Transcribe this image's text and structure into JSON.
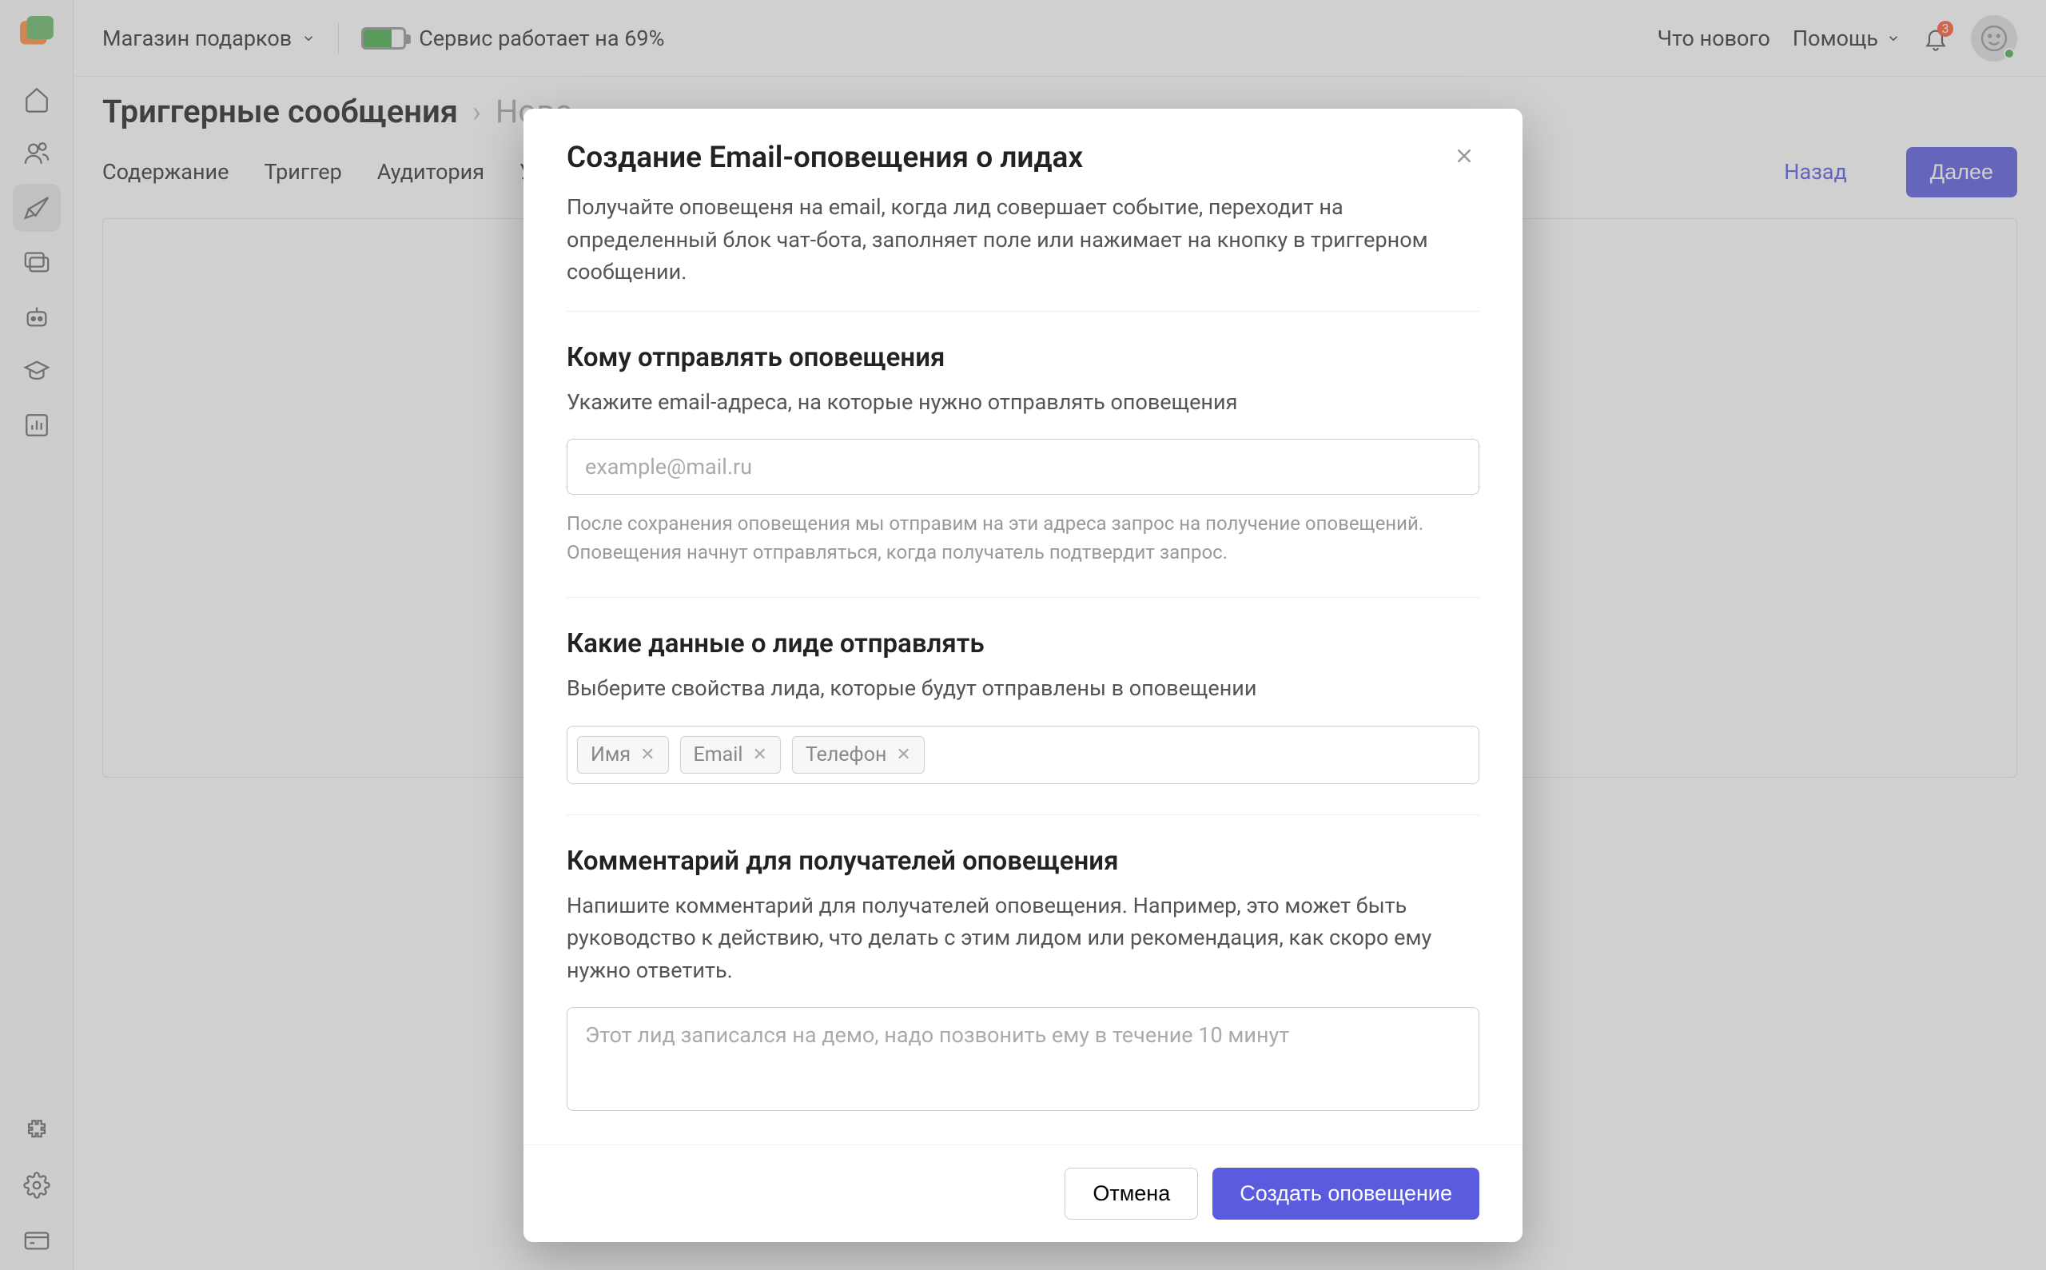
{
  "topbar": {
    "site": "Магазин подарков",
    "status": "Сервис работает на 69%",
    "whatsnew": "Что нового",
    "help": "Помощь",
    "badge": "3"
  },
  "breadcrumb": {
    "main": "Триггерные сообщения",
    "sub": "Ново"
  },
  "tabs": {
    "content": "Содержание",
    "trigger": "Триггер",
    "audience": "Аудитория",
    "conditions": "У"
  },
  "buttons": {
    "back": "Назад",
    "next": "Далее"
  },
  "modal": {
    "title": "Создание Email-оповещения о лидах",
    "desc": "Получайте оповещеня на email, когда лид совершает событие, переходит на определенный блок чат-бота, заполняет поле или нажимает на кнопку в триггерном сообщении.",
    "s1_title": "Кому отправлять оповещения",
    "s1_sub": "Укажите email-адреса, на которые нужно отправлять оповещения",
    "email_placeholder": "example@mail.ru",
    "s1_hint": "После сохранения оповещения мы отправим на эти адреса запрос на получение оповещений. Оповещения начнут отправляться, когда получатель подтвердит запрос.",
    "s2_title": "Какие данные о лиде отправлять",
    "s2_sub": "Выберите свойства лида, которые будут отправлены в оповещении",
    "tags": [
      "Имя",
      "Email",
      "Телефон"
    ],
    "s3_title": "Комментарий для получателей оповещения",
    "s3_sub": "Напишите комментарий для получателей оповещения. Например, это может быть руководство к действию, что делать с этим лидом или рекомендация, как скоро ему нужно ответить.",
    "comment_placeholder": "Этот лид записался на демо, надо позвонить ему в течение 10 минут",
    "cancel": "Отмена",
    "create": "Создать оповещение"
  }
}
